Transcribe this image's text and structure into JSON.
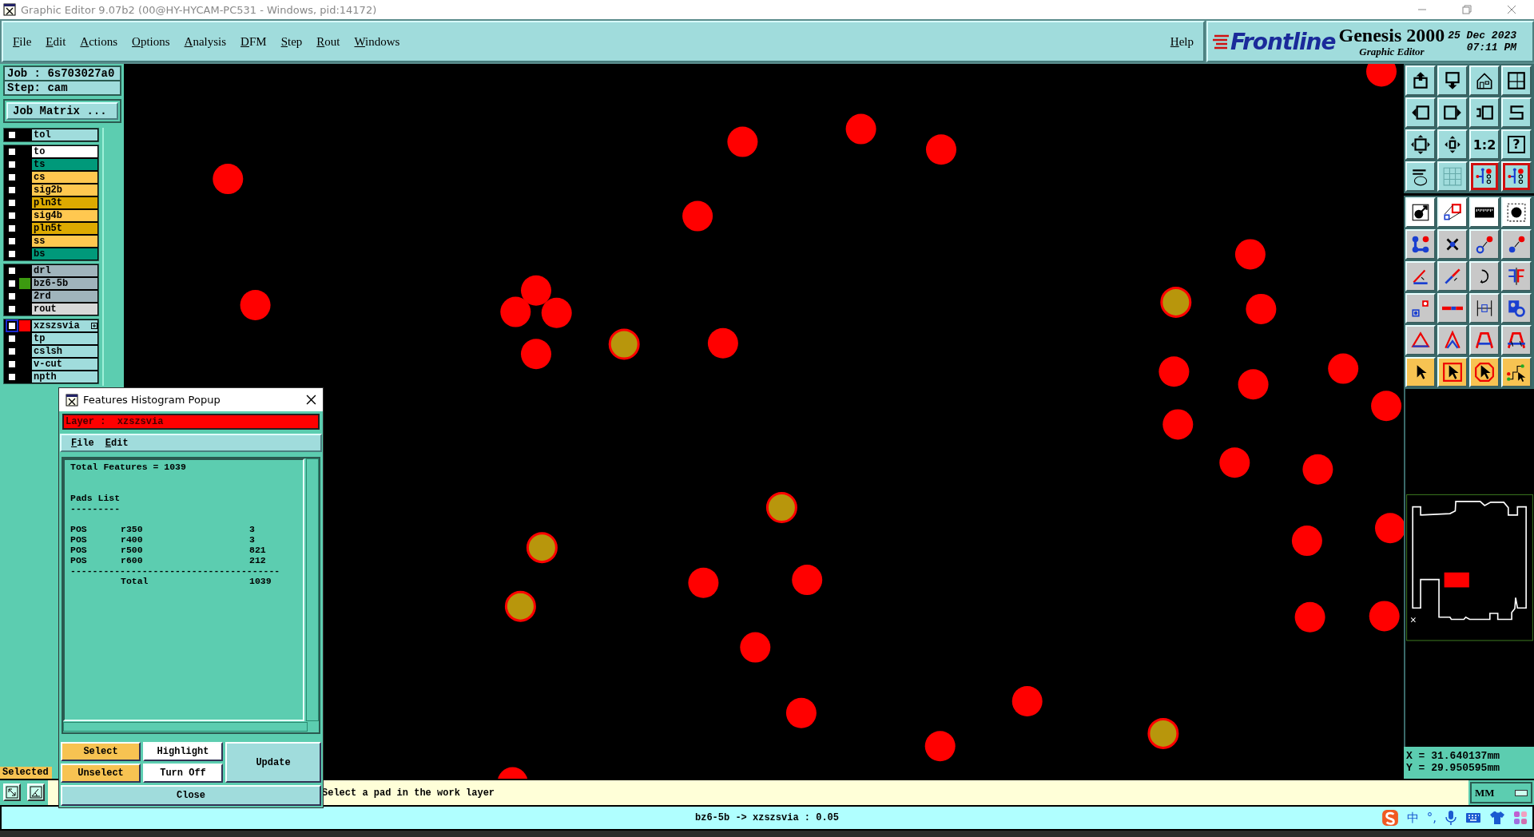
{
  "window": {
    "title": "Graphic Editor 9.07b2 (00@HY-HYCAM-PC531 - Windows, pid:14172)"
  },
  "menu": [
    "File",
    "Edit",
    "Actions",
    "Options",
    "Analysis",
    "DFM",
    "Step",
    "Rout",
    "Windows"
  ],
  "help": "Help",
  "brand": {
    "logo": "Frontline",
    "product": "Genesis 2000",
    "subtitle": "Graphic Editor",
    "date": "25 Dec 2023",
    "time": "07:11 PM"
  },
  "job": {
    "job": "Job : 6s703027a0",
    "step": "Step: cam",
    "matrix_button": "Job Matrix ..."
  },
  "layer_groups": [
    {
      "layers": [
        {
          "name": "tol",
          "color": "#a0dcdc",
          "checked": false,
          "work": false
        }
      ]
    },
    {
      "layers": [
        {
          "name": "to",
          "color": "#ffffff",
          "checked": false,
          "work": false
        },
        {
          "name": "ts",
          "color": "#00997a",
          "checked": false,
          "work": false
        },
        {
          "name": "cs",
          "color": "#ffc850",
          "checked": false,
          "work": false
        },
        {
          "name": "sig2b",
          "color": "#ffc850",
          "checked": false,
          "work": false
        },
        {
          "name": "pln3t",
          "color": "#ddaa00",
          "checked": false,
          "work": false
        },
        {
          "name": "sig4b",
          "color": "#ffc850",
          "checked": false,
          "work": false
        },
        {
          "name": "pln5t",
          "color": "#ddaa00",
          "checked": false,
          "work": false
        },
        {
          "name": "ss",
          "color": "#ffc850",
          "checked": false,
          "work": false
        },
        {
          "name": "bs",
          "color": "#00997a",
          "checked": false,
          "work": false
        }
      ]
    },
    {
      "layers": [
        {
          "name": "drl",
          "color": "#a0b4bc",
          "checked": false,
          "work": false
        },
        {
          "name": "bz6-5b",
          "color": "#a0b4bc",
          "display": {
            "color": "#3c9a10"
          },
          "checked": false,
          "work": false
        },
        {
          "name": "2rd",
          "color": "#a0b4bc",
          "checked": false,
          "work": false
        },
        {
          "name": "rout",
          "color": "#d8d8d8",
          "checked": false,
          "work": false
        }
      ]
    },
    {
      "layers": [
        {
          "name": "xzszsvia",
          "color": "#a0dcdc",
          "display": {
            "color": "#ff0000"
          },
          "checked": false,
          "work": true
        },
        {
          "name": "tp",
          "color": "#a0dcdc",
          "checked": false,
          "work": false
        },
        {
          "name": "cslsh",
          "color": "#a0dcdc",
          "checked": false,
          "work": false
        },
        {
          "name": "v-cut",
          "color": "#a0dcdc",
          "checked": false,
          "work": false
        },
        {
          "name": "npth",
          "color": "#a0dcdc",
          "checked": false,
          "work": false
        }
      ]
    }
  ],
  "selected_label": "Selected",
  "toolbar": {
    "scale_label": "1:2",
    "help_label": "?"
  },
  "coordinates": {
    "x": "X = 31.640137mm",
    "y": "Y = 29.950595mm"
  },
  "prompt": "Select a pad in the work layer",
  "units": "MM",
  "status": "bz6-5b -> xzszsvia : 0.05",
  "tray": {
    "ime_mode": "中",
    "punctuation": "°,"
  },
  "popup": {
    "title": "Features Histogram Popup",
    "layer": "Layer :  xzszsvia",
    "menu": [
      "File",
      "Edit"
    ],
    "total": "Total Features = 1039",
    "section": "Pads List",
    "underline": "---------",
    "rows": [
      {
        "polarity": "POS",
        "symbol": "r350",
        "count": "3"
      },
      {
        "polarity": "POS",
        "symbol": "r400",
        "count": "3"
      },
      {
        "polarity": "POS",
        "symbol": "r500",
        "count": "821"
      },
      {
        "polarity": "POS",
        "symbol": "r600",
        "count": "212"
      }
    ],
    "rule": "--------------------------------------",
    "total_row": {
      "label": "Total",
      "count": "1039"
    },
    "buttons": {
      "select": "Select",
      "unselect": "Unselect",
      "highlight": "Highlight",
      "turn_off": "Turn Off",
      "update": "Update",
      "close": "Close"
    }
  }
}
